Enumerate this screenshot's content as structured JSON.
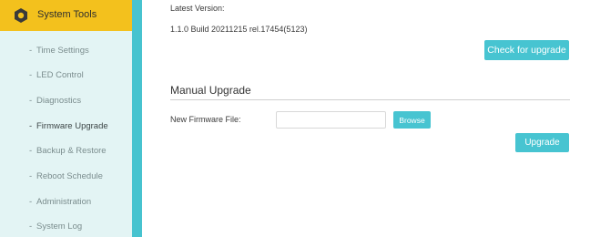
{
  "sidebar": {
    "header": {
      "label": "System Tools",
      "icon": "gear-icon"
    },
    "items": [
      {
        "label": "Time Settings",
        "active": false
      },
      {
        "label": "LED Control",
        "active": false
      },
      {
        "label": "Diagnostics",
        "active": false
      },
      {
        "label": "Firmware Upgrade",
        "active": true
      },
      {
        "label": "Backup & Restore",
        "active": false
      },
      {
        "label": "Reboot Schedule",
        "active": false
      },
      {
        "label": "Administration",
        "active": false
      },
      {
        "label": "System Log",
        "active": false
      }
    ]
  },
  "main": {
    "latest_version_label": "Latest Version:",
    "latest_version_value": "1.1.0 Build 20211215 rel.17454(5123)",
    "check_button": "Check for upgrade",
    "manual_title": "Manual Upgrade",
    "firmware_label": "New Firmware File:",
    "firmware_value": "",
    "browse_button": "Browse",
    "upgrade_button": "Upgrade"
  },
  "colors": {
    "header_bg": "#f3c11d",
    "sidebar_bg": "#e3f4f4",
    "accent": "#47c4d1"
  }
}
